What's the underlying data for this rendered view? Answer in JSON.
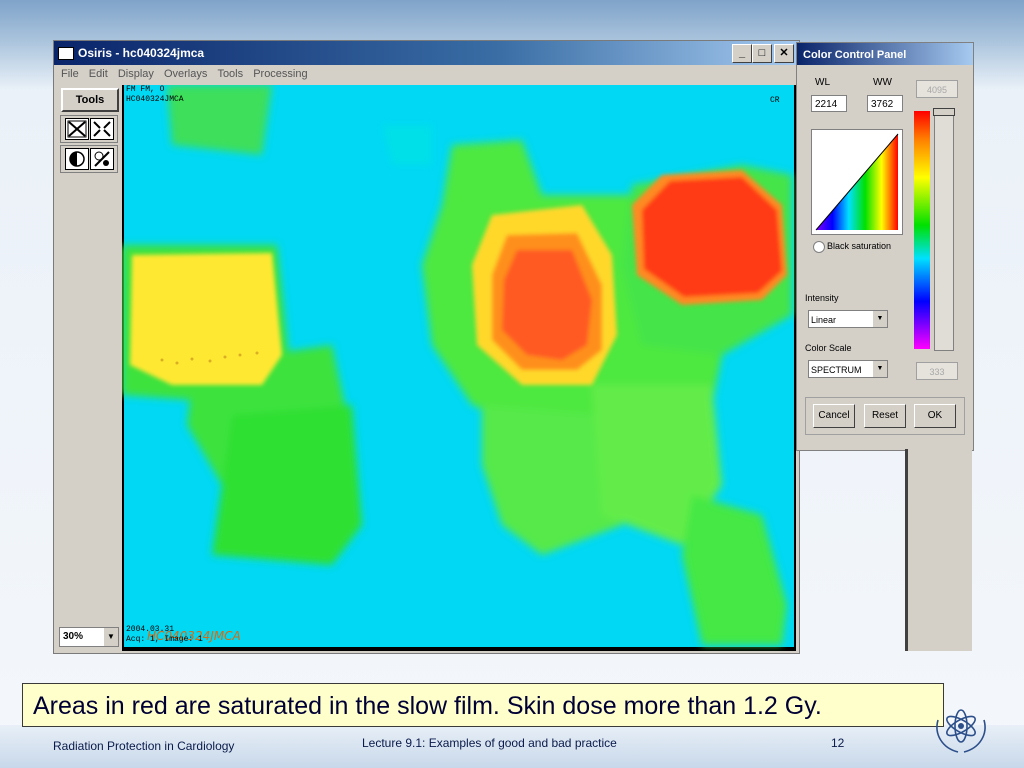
{
  "window": {
    "title": "Osiris - hc040324jmca",
    "menu": [
      "File",
      "Edit",
      "Display",
      "Overlays",
      "Tools",
      "Processing"
    ],
    "minimize": "_",
    "maximize": "□",
    "close": "✕"
  },
  "left_panel": {
    "tools_label": "Tools",
    "zoom_value": "30%",
    "icons": [
      "fit-icon",
      "zoom-icon",
      "contrast-icon",
      "invert-icon"
    ]
  },
  "viewer": {
    "overlay_top_left_1": "FM FM, O",
    "overlay_top_left_2": "HC040324JMCA",
    "overlay_top_right": "CR",
    "overlay_bottom_1": "2004.03.31",
    "overlay_bottom_2": "Acq: 1, Image: 1",
    "handwritten": "HC040324JMCA"
  },
  "color_panel": {
    "title": "Color Control Panel",
    "wl_label": "WL",
    "ww_label": "WW",
    "wl_value": "2214",
    "ww_value": "3762",
    "top_value": "4095",
    "bottom_value": "333",
    "black_saturation_label": "Black saturation",
    "intensity_label": "Intensity",
    "intensity_value": "Linear",
    "color_scale_label": "Color Scale",
    "color_scale_value": "SPECTRUM",
    "cancel": "Cancel",
    "reset": "Reset",
    "ok": "OK"
  },
  "caption": "Areas in red are saturated in the slow film. Skin dose more than 1.2 Gy.",
  "footer": {
    "left": "Radiation Protection in Cardiology",
    "middle": "Lecture 9.1: Examples of good and bad practice",
    "page": "12"
  },
  "colors": {
    "background": "#00e0ff",
    "saturated": "#ff3b1a",
    "mid": "#33e633",
    "yellow": "#ffee33",
    "caption_bg": "#ffffcc"
  }
}
